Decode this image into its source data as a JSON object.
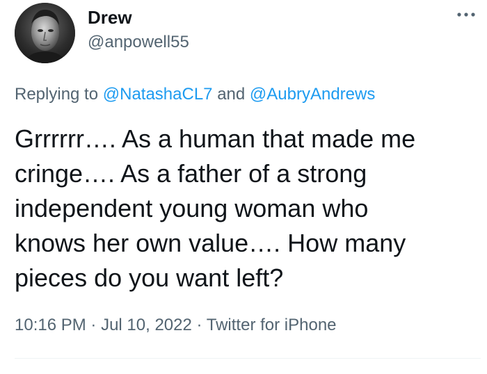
{
  "author": {
    "display_name": "Drew",
    "handle": "@anpowell55"
  },
  "reply_context": {
    "prefix": "Replying to",
    "mention_1": "@NatashaCL7",
    "conjunction": "and",
    "mention_2": "@AubryAndrews"
  },
  "tweet": {
    "text": "Grrrrrr….  As a human that made me\ncringe…. As a father of a strong\nindependent young woman who\nknows her own value…. How many\npieces do you want left?"
  },
  "meta": {
    "time": "10:16 PM",
    "separator": "·",
    "date": "Jul 10, 2022",
    "source": "Twitter for iPhone"
  },
  "icons": {
    "more": "more-horizontal-icon",
    "avatar": "profile-photo"
  },
  "colors": {
    "text_primary": "#0f1419",
    "text_secondary": "#536471",
    "link": "#1d9bf0",
    "divider": "#eff3f4"
  }
}
